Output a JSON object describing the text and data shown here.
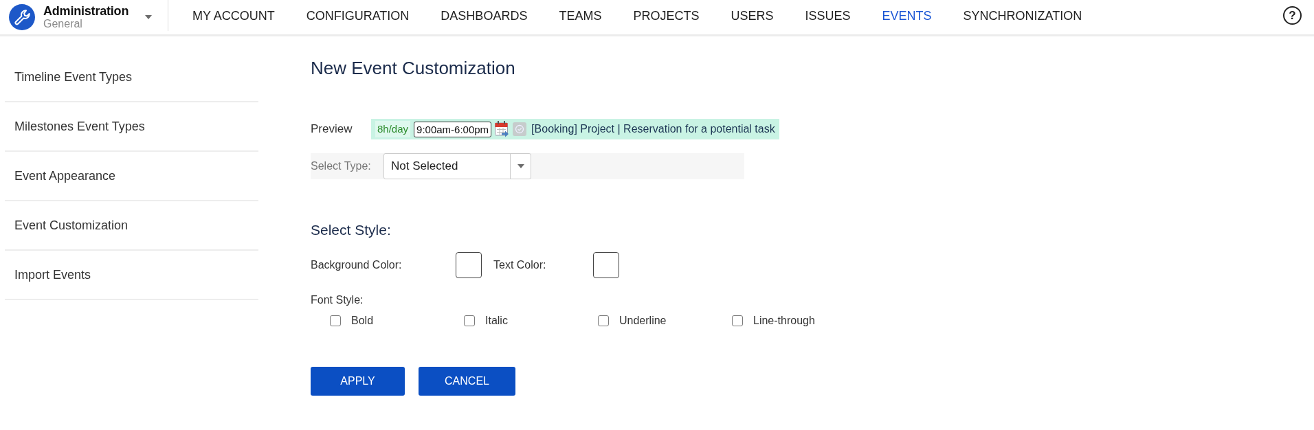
{
  "app_switcher": {
    "title": "Administration",
    "subtitle": "General"
  },
  "nav": {
    "tabs": [
      {
        "label": "MY ACCOUNT",
        "selected": false
      },
      {
        "label": "CONFIGURATION",
        "selected": false
      },
      {
        "label": "DASHBOARDS",
        "selected": false
      },
      {
        "label": "TEAMS",
        "selected": false
      },
      {
        "label": "PROJECTS",
        "selected": false
      },
      {
        "label": "USERS",
        "selected": false
      },
      {
        "label": "ISSUES",
        "selected": false
      },
      {
        "label": "EVENTS",
        "selected": true
      },
      {
        "label": "SYNCHRONIZATION",
        "selected": false
      }
    ],
    "help": "?"
  },
  "sidebar": {
    "items": [
      "Timeline Event Types",
      "Milestones Event Types",
      "Event Appearance",
      "Event Customization",
      "Import Events"
    ]
  },
  "form": {
    "title": "New Event Customization",
    "preview": {
      "label": "Preview",
      "hours": "8h/day",
      "time_range": "9:00am-6:00pm",
      "event_text": "[Booking] Project | Reservation for a potential task"
    },
    "select_type": {
      "label": "Select Type:",
      "value": "Not Selected"
    },
    "style": {
      "heading": "Select Style:",
      "background_color_label": "Background Color:",
      "text_color_label": "Text Color:",
      "font_style_label": "Font Style:",
      "font_options": [
        {
          "label": "Bold",
          "checked": false
        },
        {
          "label": "Italic",
          "checked": false
        },
        {
          "label": "Underline",
          "checked": false
        },
        {
          "label": "Line-through",
          "checked": false
        }
      ]
    },
    "buttons": [
      "APPLY",
      "CANCEL"
    ]
  }
}
